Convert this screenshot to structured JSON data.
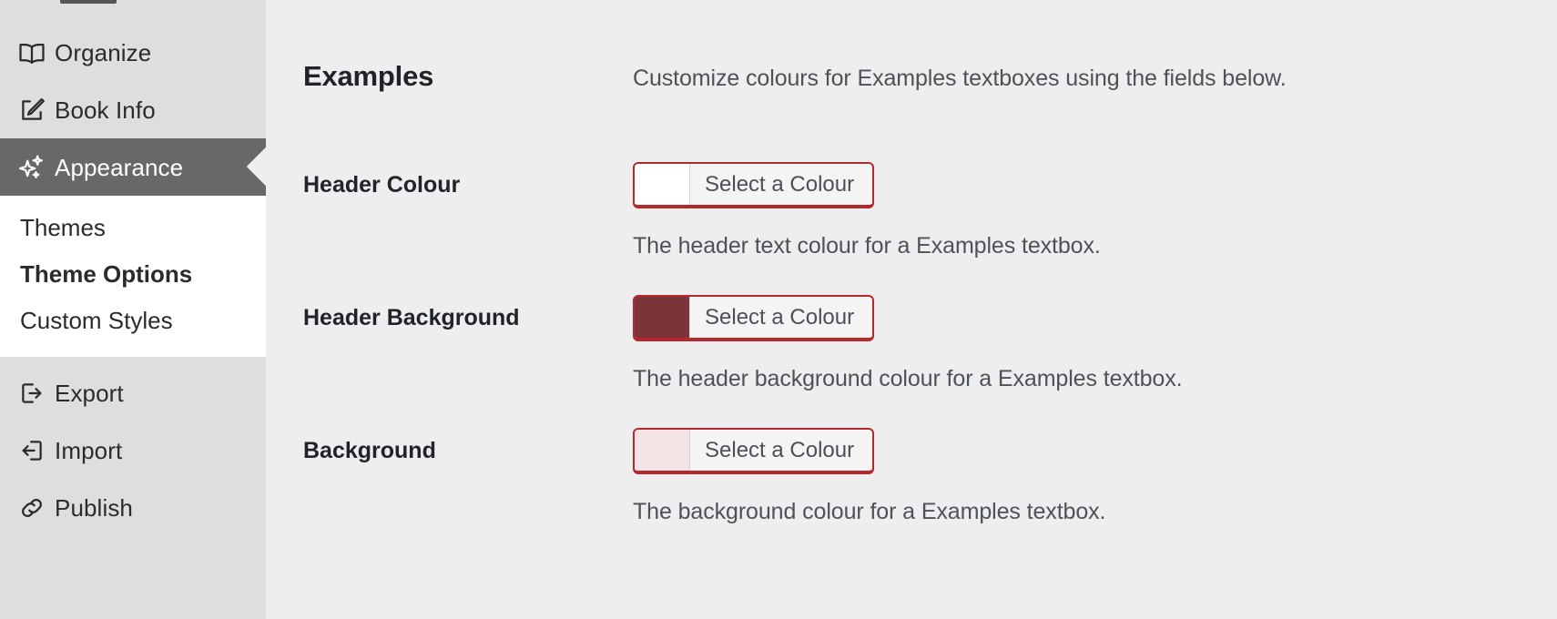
{
  "sidebar": {
    "primary_items": [
      {
        "label": "Organize",
        "icon": "book-open-icon",
        "active": false
      },
      {
        "label": "Book Info",
        "icon": "edit-square-icon",
        "active": false
      },
      {
        "label": "Appearance",
        "icon": "sparkles-icon",
        "active": true
      }
    ],
    "sub_items": [
      {
        "label": "Themes",
        "current": false
      },
      {
        "label": "Theme Options",
        "current": true
      },
      {
        "label": "Custom Styles",
        "current": false
      }
    ],
    "secondary_items": [
      {
        "label": "Export",
        "icon": "export-icon"
      },
      {
        "label": "Import",
        "icon": "import-icon"
      },
      {
        "label": "Publish",
        "icon": "link-chain-icon"
      }
    ]
  },
  "main": {
    "section_title": "Examples",
    "section_description": "Customize colours for Examples textboxes using the fields below.",
    "fields": [
      {
        "label": "Header Colour",
        "button_label": "Select a Colour",
        "swatch_colour": "#ffffff",
        "help": "The header text colour for a Examples textbox."
      },
      {
        "label": "Header Background",
        "button_label": "Select a Colour",
        "swatch_colour": "#7b3439",
        "help": "The header background colour for a Examples textbox."
      },
      {
        "label": "Background",
        "button_label": "Select a Colour",
        "swatch_colour": "#f4e4e5",
        "help": "The background colour for a Examples textbox."
      }
    ]
  },
  "colors": {
    "sidebar_bg": "#dededd",
    "sidebar_sub_bg": "#ffffff",
    "active_bg": "#686868",
    "active_text": "#ffffff",
    "page_bg": "#efeeee",
    "accent_border": "#b4282e",
    "heading_text": "#20242a",
    "body_text": "#4d5259"
  }
}
